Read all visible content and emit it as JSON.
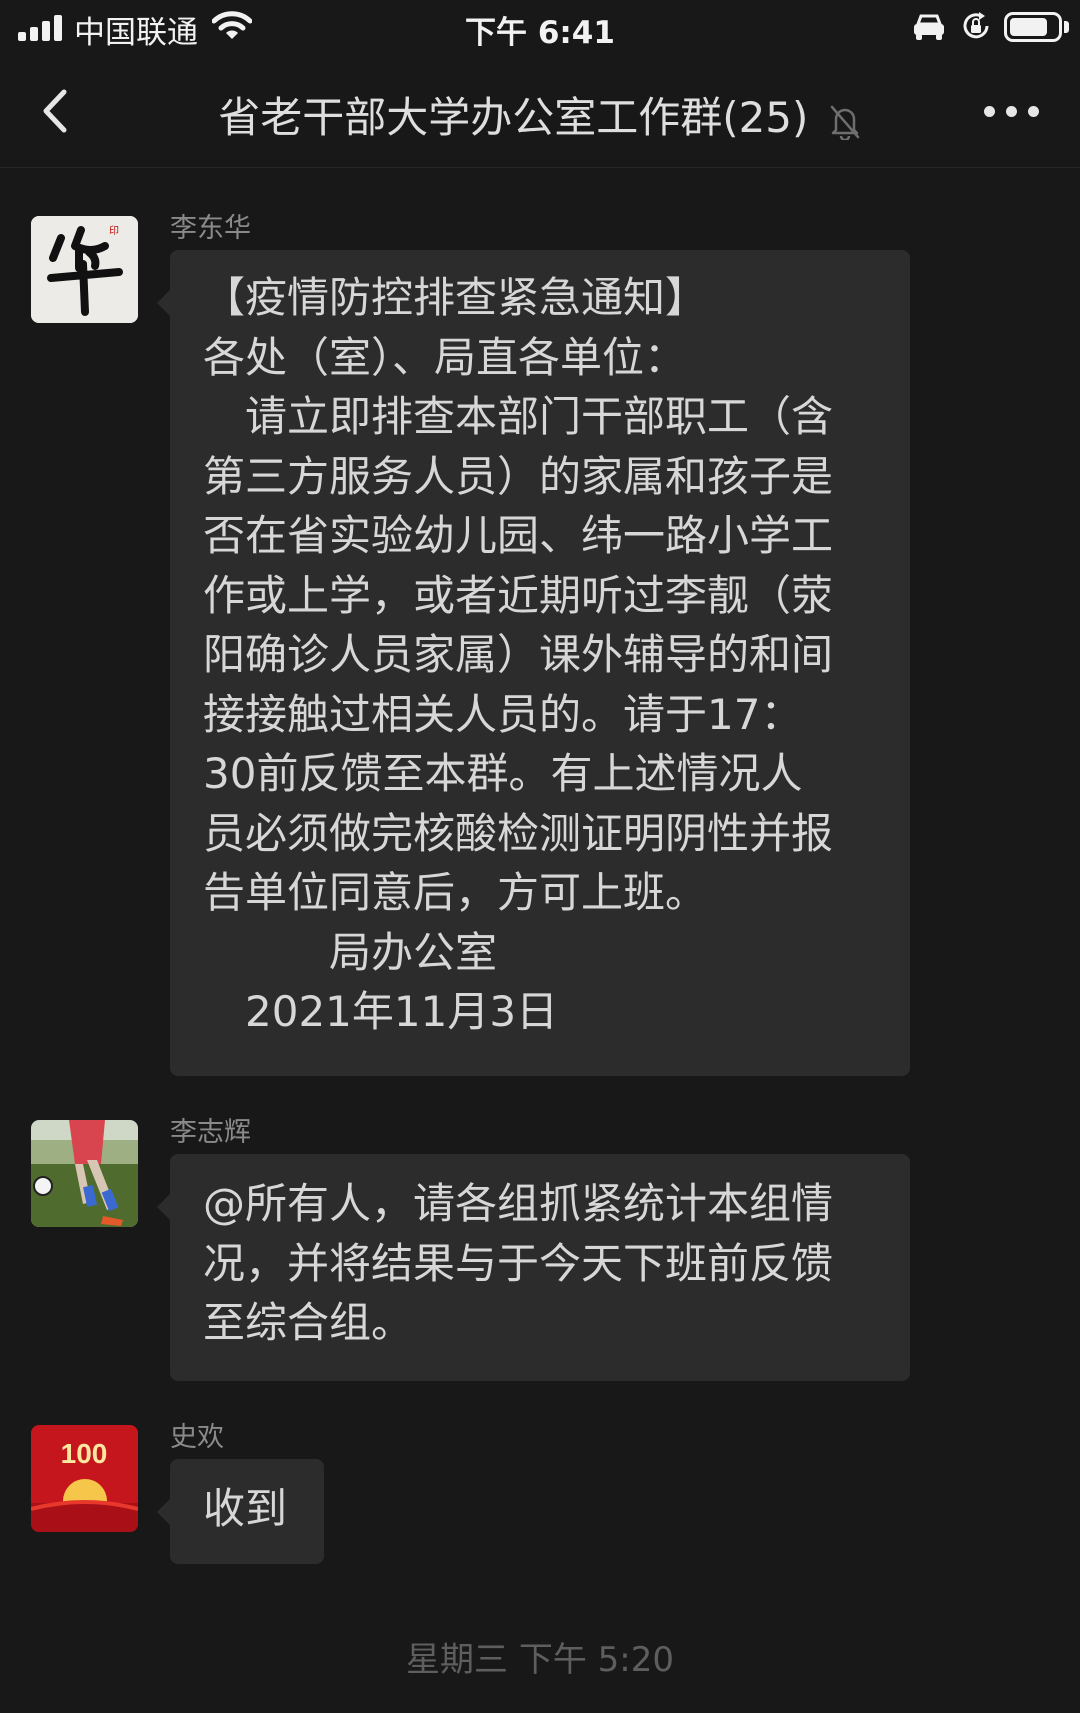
{
  "status_bar": {
    "carrier": "中国联通",
    "time": "下午 6:41",
    "battery_level": 0.8
  },
  "nav": {
    "title": "省老干部大学办公室工作群(25)",
    "back_icon": "chevron-left-icon",
    "mute_icon": "bell-off-icon",
    "more_icon": "ellipsis-icon"
  },
  "messages": [
    {
      "sender": "李东华",
      "avatar_char": "华",
      "lines": [
        "【疫情防控排查紧急通知】",
        "各处（室）、局直各单位：",
        "　请立即排查本部门干部职工（含",
        "第三方服务人员）的家属和孩子是",
        "否在省实验幼儿园、纬一路小学工",
        "作或上学，或者近期听过李靓（荥",
        "阳确诊人员家属）课外辅导的和间",
        "接接触过相关人员的。请于17：",
        "30前反馈至本群。有上述情况人",
        "员必须做完核酸检测证明阴性并报",
        "告单位同意后，方可上班。",
        "　　　局办公室",
        "　2021年11月3日"
      ]
    },
    {
      "sender": "李志辉",
      "lines": [
        "@所有人，请各组抓紧统计本组情",
        "况，并将结果与于今天下班前反馈",
        "至综合组。"
      ]
    },
    {
      "sender": "史欢",
      "avatar_text": "100",
      "lines": [
        "收到"
      ]
    }
  ],
  "timestamp": "星期三 下午 5:20",
  "colors": {
    "background": "#181818",
    "bubble": "#2c2c2c",
    "sender_name": "#8a8a8a",
    "text": "#d7d7d7"
  }
}
